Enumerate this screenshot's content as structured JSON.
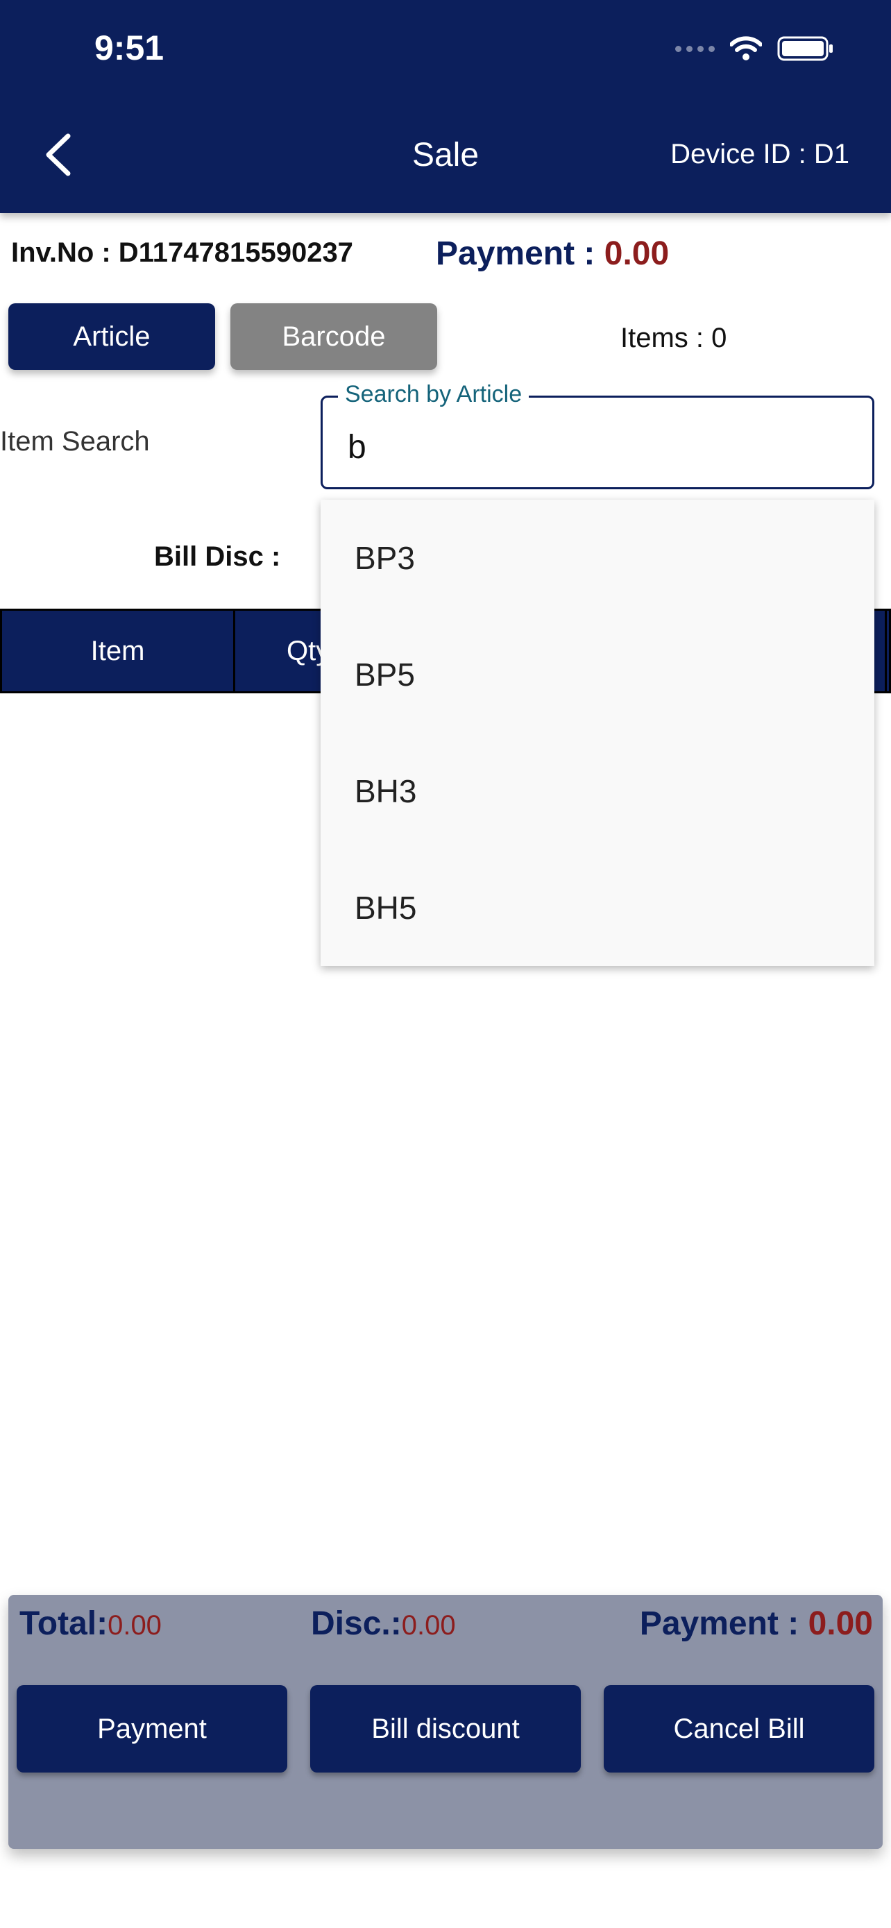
{
  "status_bar": {
    "time": "9:51"
  },
  "header": {
    "title": "Sale",
    "device_id": "Device ID : D1"
  },
  "invoice": {
    "number": "Inv.No : D11747815590237",
    "payment_label": "Payment : ",
    "payment_value": "0.00"
  },
  "search_mode": {
    "article_label": "Article",
    "barcode_label": "Barcode"
  },
  "items_count": "Items : 0",
  "item_search": {
    "label": "Item Search",
    "field_label": "Search by Article",
    "value": "b",
    "suggestions": [
      "BP3",
      "BP5",
      "BH3",
      "BH5"
    ]
  },
  "bill_disc_label": "Bill Disc :",
  "table": {
    "columns": [
      "Item",
      "Qty"
    ]
  },
  "footer": {
    "total_label": "Total:",
    "total_value": "0.00",
    "disc_label": "Disc.:",
    "disc_value": "0.00",
    "payment_label": "Payment : ",
    "payment_value": "0.00",
    "buttons": [
      "Payment",
      "Bill discount",
      "Cancel Bill"
    ]
  },
  "colors": {
    "brand_navy": "#0c1f5c",
    "amount_red": "#8c1d1d",
    "inactive_gray": "#838383",
    "footer_panel": "#8c92a6"
  },
  "icons": [
    "back-chevron-icon",
    "cellular-signal-icon",
    "wifi-icon",
    "battery-icon"
  ]
}
